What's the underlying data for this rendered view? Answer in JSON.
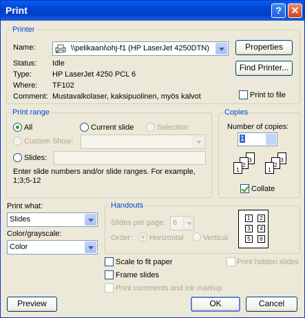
{
  "window": {
    "title": "Print",
    "help": "?",
    "close": "✕"
  },
  "printer": {
    "group_label": "Printer",
    "name_label": "Name:",
    "name_value": "\\\\pelikaani\\ohj-f1 (HP LaserJet 4250DTN)",
    "properties": "Properties",
    "find_printer": "Find Printer...",
    "status_label": "Status:",
    "status_value": "Idle",
    "type_label": "Type:",
    "type_value": "HP LaserJet 4250 PCL 6",
    "where_label": "Where:",
    "where_value": "TF102",
    "comment_label": "Comment:",
    "comment_value": "Mustavalkolaser, kaksipuolinen, myös kalvot",
    "print_to_file": "Print to file"
  },
  "print_range": {
    "group_label": "Print range",
    "all": "All",
    "current_slide": "Current slide",
    "selection": "Selection",
    "custom_show": "Custom Show:",
    "slides": "Slides:",
    "hint": "Enter slide numbers and/or slide ranges. For example, 1;3;5-12"
  },
  "copies": {
    "group_label": "Copies",
    "number_label": "Number of copies:",
    "number_value": "1",
    "collate": "Collate",
    "pages_left": [
      "1",
      "2",
      "3"
    ],
    "pages_right": [
      "1",
      "2",
      "3"
    ]
  },
  "print_what": {
    "label": "Print what:",
    "value": "Slides"
  },
  "color": {
    "label": "Color/grayscale:",
    "value": "Color"
  },
  "handouts": {
    "group_label": "Handouts",
    "slides_per_page_label": "Slides per page:",
    "slides_per_page_value": "6",
    "order_label": "Order:",
    "horizontal": "Horizontal",
    "vertical": "Vertical",
    "preview_cells": [
      "1",
      "2",
      "3",
      "4",
      "5",
      "6"
    ]
  },
  "options": {
    "scale_to_fit": "Scale to fit paper",
    "frame_slides": "Frame slides",
    "print_comments": "Print comments and ink markup",
    "print_hidden": "Print hidden slides"
  },
  "buttons": {
    "preview": "Preview",
    "ok": "OK",
    "cancel": "Cancel"
  }
}
